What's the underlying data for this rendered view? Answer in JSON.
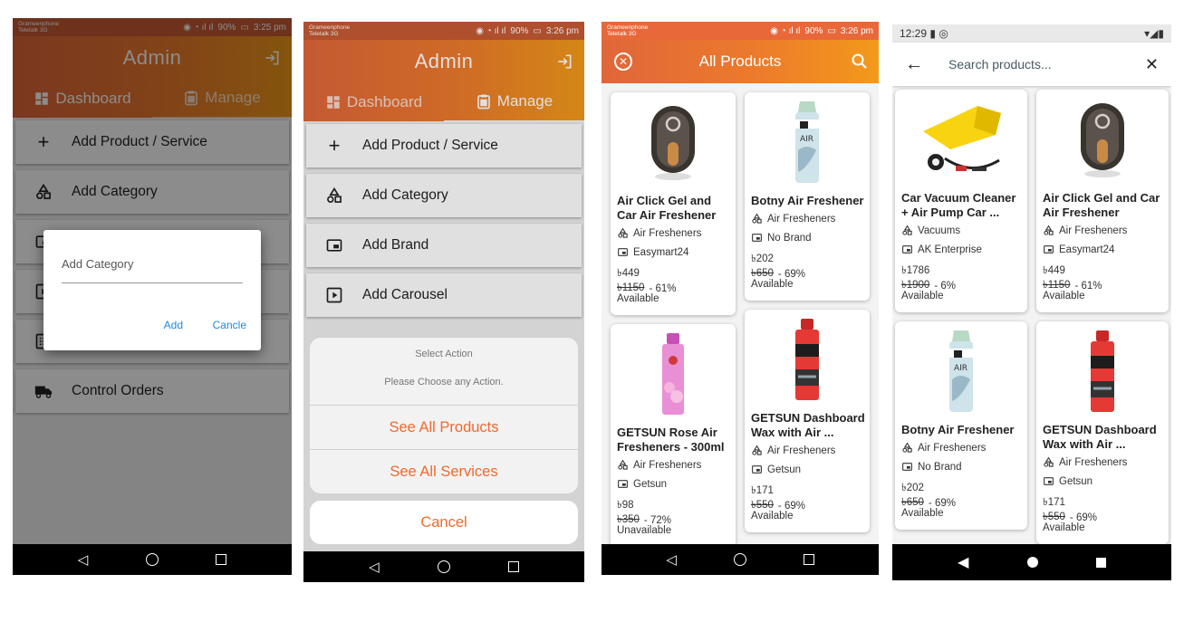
{
  "status_bar": {
    "carrier_line1": "Grameenphone",
    "carrier_line2": "Teletalk 3G",
    "battery": "90%",
    "time_1": "3:25 pm",
    "time_2": "3:26 pm",
    "time_3": "3:26 pm",
    "time_4": "12:29"
  },
  "admin": {
    "title": "Admin",
    "tabs": [
      {
        "label": "Dashboard",
        "icon": "dashboard-icon"
      },
      {
        "label": "Manage",
        "icon": "clipboard-icon"
      }
    ],
    "menu": [
      {
        "label": "Add Product / Service",
        "icon": "plus-icon"
      },
      {
        "label": "Add Category",
        "icon": "shapes-icon"
      },
      {
        "label": "Add Brand",
        "icon": "brand-icon"
      },
      {
        "label": "Add Carousel",
        "icon": "play-box-icon"
      },
      {
        "label": "",
        "icon": "list-icon"
      },
      {
        "label": "Control Orders",
        "icon": "truck-icon"
      }
    ]
  },
  "add_category_dialog": {
    "placeholder": "Add Category",
    "add_label": "Add",
    "cancel_label": "Cancle"
  },
  "action_sheet": {
    "title": "Select Action",
    "message": "Please Choose any Action.",
    "options": [
      "See All Products",
      "See All Services"
    ],
    "cancel_label": "Cancel"
  },
  "all_products": {
    "title": "All Products",
    "products": [
      {
        "name_line1": "Air Click Gel and",
        "name_line2": "Car Air Freshener",
        "category": "Air Fresheners",
        "brand": "Easymart24",
        "price": "৳449",
        "old_price": "৳1150",
        "discount": " - 61%",
        "availability": "Available",
        "image": "gel-freshener-image"
      },
      {
        "name_line1": "Botny Air Freshener",
        "name_line2": "",
        "category": "Air Fresheners",
        "brand": "No Brand",
        "price": "৳202",
        "old_price": "৳650",
        "discount": " - 69%",
        "availability": "Available",
        "image": "spray-can-image"
      },
      {
        "name_line1": "GETSUN Rose Air",
        "name_line2": "Fresheners - 300ml",
        "category": "Air Fresheners",
        "brand": "Getsun",
        "price": "৳98",
        "old_price": "৳350",
        "discount": " - 72%",
        "availability": "Unavailable",
        "image": "rose-spray-image"
      },
      {
        "name_line1": "GETSUN Dashboard",
        "name_line2": "Wax with Air ...",
        "category": "Air Fresheners",
        "brand": "Getsun",
        "price": "৳171",
        "old_price": "৳550",
        "discount": " - 69%",
        "availability": "Available",
        "image": "red-spray-image"
      }
    ]
  },
  "search_screen": {
    "placeholder": "Search products...",
    "products": [
      {
        "name_line1": "Car Vacuum Cleaner",
        "name_line2": "+ Air Pump Car ...",
        "category": "Vacuums",
        "brand": "AK Enterprise",
        "price": "৳1786",
        "old_price": "৳1900",
        "discount": " - 6%",
        "availability": "Available",
        "image": "vacuum-image"
      },
      {
        "name_line1": "Air Click Gel and Car",
        "name_line2": "Air Freshener",
        "category": "Air Fresheners",
        "brand": "Easymart24",
        "price": "৳449",
        "old_price": "৳1150",
        "discount": " - 61%",
        "availability": "Available",
        "image": "gel-freshener-image"
      },
      {
        "name_line1": "Botny Air Freshener",
        "name_line2": "",
        "category": "Air Fresheners",
        "brand": "No Brand",
        "price": "৳202",
        "old_price": "৳650",
        "discount": " - 69%",
        "availability": "Available",
        "image": "spray-can-image"
      },
      {
        "name_line1": "GETSUN Dashboard",
        "name_line2": "Wax with Air ...",
        "category": "Air Fresheners",
        "brand": "Getsun",
        "price": "৳171",
        "old_price": "৳550",
        "discount": " - 69%",
        "availability": "Available",
        "image": "red-spray-image"
      }
    ]
  },
  "colors": {
    "accent_orange": "#ef6a2c",
    "gradient_start": "#e0663a",
    "gradient_end": "#f29a1a",
    "dialog_button_blue": "#1e88e5"
  }
}
